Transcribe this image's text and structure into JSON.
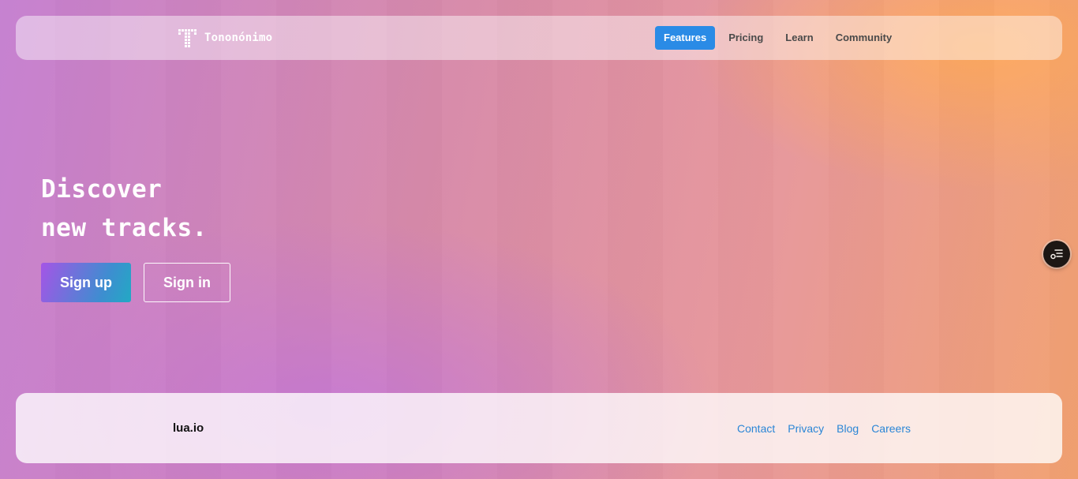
{
  "navbar": {
    "brand_name": "Tononónimo",
    "brand_icon": "pixel-t-logo-icon",
    "links": [
      {
        "label": "Features",
        "active": true
      },
      {
        "label": "Pricing",
        "active": false
      },
      {
        "label": "Learn",
        "active": false
      },
      {
        "label": "Community",
        "active": false
      }
    ],
    "active_color": "#2a8be6"
  },
  "hero": {
    "title_line1": "Discover",
    "title_line2": "new tracks.",
    "signup_label": "Sign up",
    "signin_label": "Sign in"
  },
  "fab": {
    "icon": "filter-settings-icon"
  },
  "footer": {
    "brand": "lua.io",
    "links": [
      "Contact",
      "Privacy",
      "Blog",
      "Careers"
    ],
    "link_color": "#2a86d6"
  },
  "colors": {
    "gradient_pink": "#c57fd0",
    "gradient_orange": "#f2a170",
    "signup_gradient_start": "#a455e6",
    "signup_gradient_end": "#22a9c4"
  }
}
